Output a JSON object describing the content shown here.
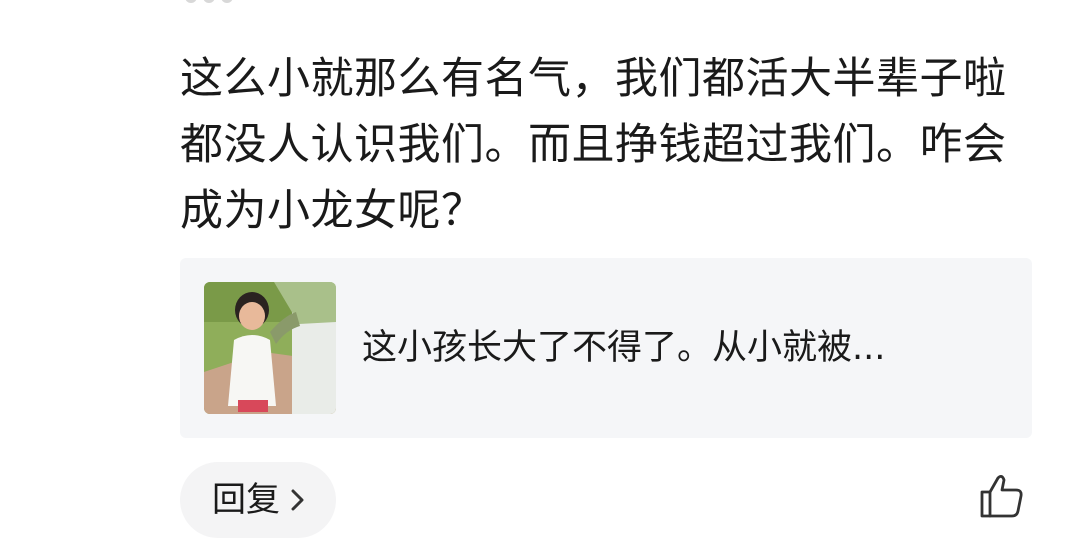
{
  "comment": {
    "text": "这么小就那么有名气，我们都活大半辈子啦都没人认识我们。而且挣钱超过我们。咋会成为小龙女呢？"
  },
  "quoted_post": {
    "thumbnail_icon": "child-photo-thumbnail",
    "text": "这小孩长大了不得了。从小就被..."
  },
  "actions": {
    "reply_label": "回复",
    "reply_icon": "chevron-right-icon",
    "like_icon": "thumbs-up-icon"
  },
  "colors": {
    "text": "#1a1a1a",
    "card_background": "#f5f6f8",
    "button_background": "#f4f4f5",
    "icon_stroke": "#333333"
  }
}
